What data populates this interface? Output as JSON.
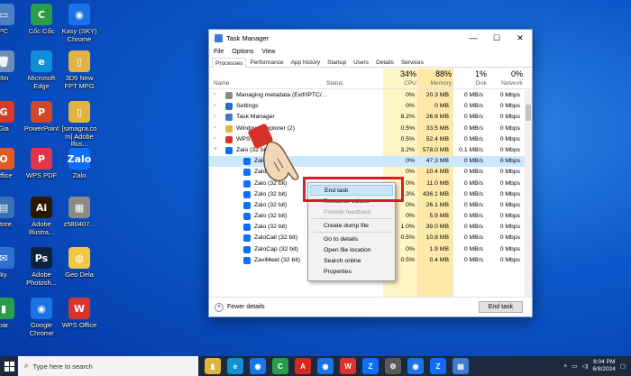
{
  "desktop": {
    "icons": [
      {
        "label": "PC",
        "color": "#4a7fc1",
        "glyph": "▭"
      },
      {
        "label": "Cốc Cốc",
        "color": "#2a9d4a",
        "glyph": "C"
      },
      {
        "label": "Kasy (SKY) Chrome",
        "color": "#1a73e8",
        "glyph": "◉"
      },
      {
        "label": "Bin",
        "color": "#6b8fb8",
        "glyph": "🗑"
      },
      {
        "label": "Microsoft Edge",
        "color": "#0f8fd8",
        "glyph": "e"
      },
      {
        "label": "3D5 New FPT MPG",
        "color": "#e3b341",
        "glyph": "▯"
      },
      {
        "label": "Gia",
        "color": "#d63a2a",
        "glyph": "G"
      },
      {
        "label": "PowerPoint",
        "color": "#d24726",
        "glyph": "P"
      },
      {
        "label": "[simagra.com] Adobe Illus...",
        "color": "#e3b341",
        "glyph": "▯"
      },
      {
        "label": "Office",
        "color": "#e05a22",
        "glyph": "O"
      },
      {
        "label": "WPS PDF",
        "color": "#e2344a",
        "glyph": "P"
      },
      {
        "label": "Zalo",
        "color": "#0d6efd",
        "glyph": "Zalo"
      },
      {
        "label": "Store",
        "color": "#3a6fb0",
        "glyph": "▤"
      },
      {
        "label": "Adobe Illustra...",
        "color": "#2b1800",
        "glyph": "Ai"
      },
      {
        "label": "z580407...",
        "color": "#8a8a8a",
        "glyph": "▦"
      },
      {
        "label": "ky",
        "color": "#2f6fd1",
        "glyph": "✉"
      },
      {
        "label": "Adobe Photosh...",
        "color": "#0c2340",
        "glyph": "Ps"
      },
      {
        "label": "Geo Dela",
        "color": "#f2c744",
        "glyph": "◍"
      },
      {
        "label": "bar",
        "color": "#2a9d4a",
        "glyph": "▮"
      },
      {
        "label": "Google Chrome",
        "color": "#1a73e8",
        "glyph": "◉"
      },
      {
        "label": "WPS Office",
        "color": "#d9342b",
        "glyph": "W"
      }
    ]
  },
  "taskmanager": {
    "title": "Task Manager",
    "controls": {
      "min": "—",
      "max": "☐",
      "close": "✕"
    },
    "menu": [
      "File",
      "Options",
      "View"
    ],
    "tabs": [
      "Processes",
      "Performance",
      "App history",
      "Startup",
      "Users",
      "Details",
      "Services"
    ],
    "columns": {
      "name": "Name",
      "status": "Status",
      "cpu": {
        "pct": "34%",
        "label": "CPU"
      },
      "memory": {
        "pct": "88%",
        "label": "Memory"
      },
      "disk": {
        "pct": "1%",
        "label": "Disk"
      },
      "network": {
        "pct": "0%",
        "label": "Network"
      }
    },
    "rows": [
      {
        "exp": "›",
        "name": "Managing metadata (Exif/IPTC/...",
        "status": "",
        "cpu": "0%",
        "mem": "20.3 MB",
        "disk": "0 MB/s",
        "net": "0 Mbps",
        "icon": "#8a8a8a",
        "level": 0
      },
      {
        "exp": "›",
        "name": "Settings",
        "status": "",
        "cpu": "0%",
        "mem": "0 MB",
        "disk": "0 MB/s",
        "net": "0 Mbps",
        "icon": "#1f6fd1",
        "level": 0
      },
      {
        "exp": "›",
        "name": "Task Manager",
        "status": "",
        "cpu": "8.2%",
        "mem": "26.6 MB",
        "disk": "0 MB/s",
        "net": "0 Mbps",
        "icon": "#3a7bd5",
        "level": 0
      },
      {
        "exp": "›",
        "name": "Windows Explorer (2)",
        "status": "",
        "cpu": "0.5%",
        "mem": "33.5 MB",
        "disk": "0 MB/s",
        "net": "0 Mbps",
        "icon": "#e3b341",
        "level": 0
      },
      {
        "exp": "›",
        "name": "WPS Office",
        "status": "",
        "cpu": "0.5%",
        "mem": "52.4 MB",
        "disk": "0 MB/s",
        "net": "0 Mbps",
        "icon": "#d9342b",
        "level": 0
      },
      {
        "exp": "˅",
        "name": "Zalo (32 bit)",
        "status": "",
        "cpu": "3.2%",
        "mem": "578.0 MB",
        "disk": "0.1 MB/s",
        "net": "0 Mbps",
        "icon": "#0d6efd",
        "level": 0
      },
      {
        "exp": "",
        "name": "Zalo (32 bit)",
        "status": "",
        "cpu": "0%",
        "mem": "47.3 MB",
        "disk": "0 MB/s",
        "net": "0 Mbps",
        "icon": "#0d6efd",
        "level": 1
      },
      {
        "exp": "",
        "name": "Zalo (32 bit)",
        "status": "",
        "cpu": "0%",
        "mem": "10.4 MB",
        "disk": "0 MB/s",
        "net": "0 Mbps",
        "icon": "#0d6efd",
        "level": 1
      },
      {
        "exp": "",
        "name": "Zalo (32 bit)",
        "status": "",
        "cpu": "0%",
        "mem": "11.0 MB",
        "disk": "0 MB/s",
        "net": "0 Mbps",
        "icon": "#0d6efd",
        "level": 1
      },
      {
        "exp": "",
        "name": "Zalo (32 bit)",
        "status": "",
        "cpu": "1.3%",
        "mem": "436.1 MB",
        "disk": "0 MB/s",
        "net": "0 Mbps",
        "icon": "#0d6efd",
        "level": 1
      },
      {
        "exp": "",
        "name": "Zalo (32 bit)",
        "status": "",
        "cpu": "0%",
        "mem": "26.1 MB",
        "disk": "0 MB/s",
        "net": "0 Mbps",
        "icon": "#0d6efd",
        "level": 1
      },
      {
        "exp": "",
        "name": "Zalo (32 bit)",
        "status": "",
        "cpu": "0%",
        "mem": "5.9 MB",
        "disk": "0 MB/s",
        "net": "0 Mbps",
        "icon": "#0d6efd",
        "level": 1
      },
      {
        "exp": "",
        "name": "Zalo (32 bit)",
        "status": "",
        "cpu": "1.0%",
        "mem": "39.0 MB",
        "disk": "0 MB/s",
        "net": "0 Mbps",
        "icon": "#0d6efd",
        "level": 1
      },
      {
        "exp": "",
        "name": "ZaloCall (32 bit)",
        "status": "",
        "cpu": "0.5%",
        "mem": "10.8 MB",
        "disk": "0 MB/s",
        "net": "0 Mbps",
        "icon": "#0d6efd",
        "level": 1
      },
      {
        "exp": "",
        "name": "ZaloCap (32 bit)",
        "status": "",
        "cpu": "0%",
        "mem": "1.9 MB",
        "disk": "0 MB/s",
        "net": "0 Mbps",
        "icon": "#0d6efd",
        "level": 1
      },
      {
        "exp": "",
        "name": "ZaviMeet (32 bit)",
        "status": "",
        "cpu": "0.5%",
        "mem": "0.4 MB",
        "disk": "0 MB/s",
        "net": "0 Mbps",
        "icon": "#0d6efd",
        "level": 1
      }
    ],
    "footer": {
      "fewer_details": "Fewer details",
      "end_task": "End task"
    },
    "colors": {
      "cpu_bg": "#fff4c4",
      "mem_bg": "#ffe9a8",
      "selected": "#cce8ff"
    }
  },
  "context_menu": {
    "items": [
      {
        "label": "End task",
        "type": "highlight"
      },
      {
        "label": "Resource values",
        "type": "normal"
      },
      {
        "label": "Provide feedback",
        "type": "disabled"
      },
      {
        "label": "",
        "type": "separator"
      },
      {
        "label": "Create dump file",
        "type": "normal"
      },
      {
        "label": "",
        "type": "separator"
      },
      {
        "label": "Go to details",
        "type": "normal"
      },
      {
        "label": "Open file location",
        "type": "normal"
      },
      {
        "label": "Search online",
        "type": "normal"
      },
      {
        "label": "Properties",
        "type": "normal"
      }
    ]
  },
  "taskbar": {
    "search_placeholder": "Type here to search",
    "apps": [
      {
        "name": "explorer",
        "color": "#e3b341",
        "glyph": "▮"
      },
      {
        "name": "edge",
        "color": "#0f8fd8",
        "glyph": "e"
      },
      {
        "name": "chrome",
        "color": "#1a73e8",
        "glyph": "◉"
      },
      {
        "name": "coccoc",
        "color": "#2a9d4a",
        "glyph": "C"
      },
      {
        "name": "acrobat",
        "color": "#d8281e",
        "glyph": "A"
      },
      {
        "name": "chrome2",
        "color": "#1a73e8",
        "glyph": "◉"
      },
      {
        "name": "wps",
        "color": "#d9342b",
        "glyph": "W"
      },
      {
        "name": "zalo",
        "color": "#0d6efd",
        "glyph": "Z"
      },
      {
        "name": "settings",
        "color": "#5a5a5a",
        "glyph": "⚙"
      },
      {
        "name": "chrome3",
        "color": "#1a73e8",
        "glyph": "◉"
      },
      {
        "name": "zalo2",
        "color": "#0d6efd",
        "glyph": "Z"
      },
      {
        "name": "taskmanager",
        "color": "#3a7bd5",
        "glyph": "▤"
      }
    ],
    "time": "8:04 PM",
    "date": "6/8/2024"
  }
}
